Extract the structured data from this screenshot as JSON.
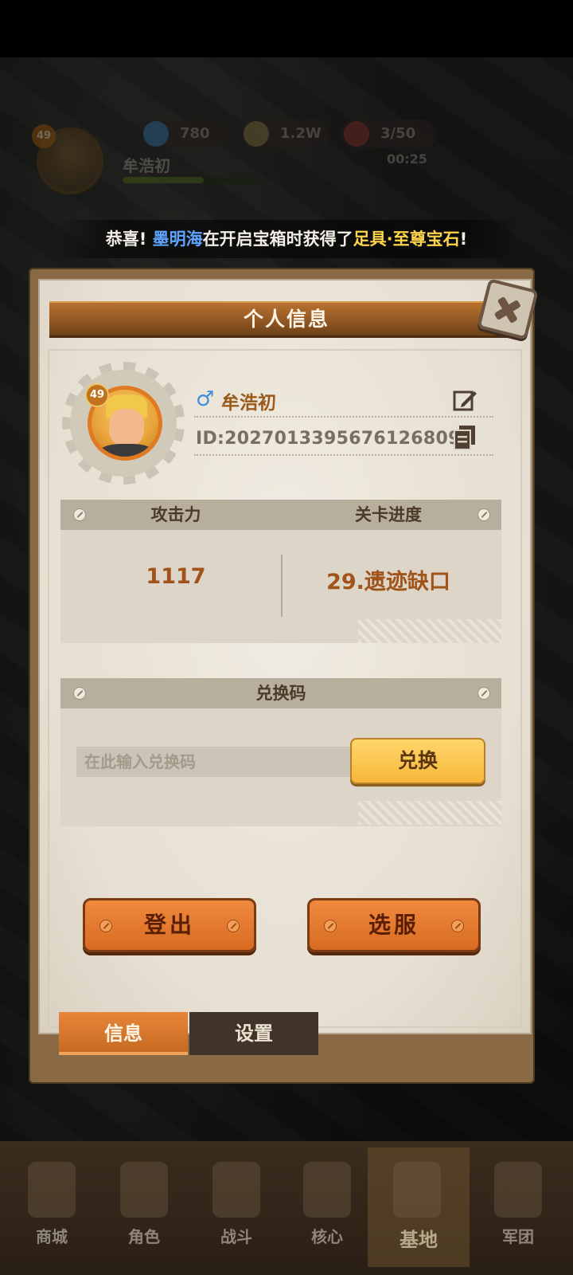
{
  "hud": {
    "level": "49",
    "name": "牟浩初",
    "gems": "780",
    "coins": "1.2W",
    "stamina": "3/50",
    "timer": "00:25"
  },
  "banner": {
    "prefix": "恭喜!",
    "player": "墨明海",
    "middle": "在开启宝箱时获得了",
    "item": "足具·至尊宝石",
    "suffix": "!"
  },
  "panel": {
    "title": "个人信息",
    "profile": {
      "level": "49",
      "gender": "♂",
      "name": "牟浩初",
      "id": "ID:2027013395676126809"
    },
    "stats": {
      "attack_label": "攻击力",
      "progress_label": "关卡进度",
      "attack_value": "1117",
      "progress_value": "29.遗迹缺口"
    },
    "redeem": {
      "title": "兑换码",
      "placeholder": "在此输入兑换码",
      "button": "兑换"
    },
    "buttons": {
      "logout": "登出",
      "select_server": "选服"
    },
    "tabs": [
      "信息",
      "设置"
    ]
  },
  "bottom_nav": [
    "商城",
    "角色",
    "战斗",
    "核心",
    "基地",
    "军团"
  ],
  "bottom_nav_active": "基地"
}
